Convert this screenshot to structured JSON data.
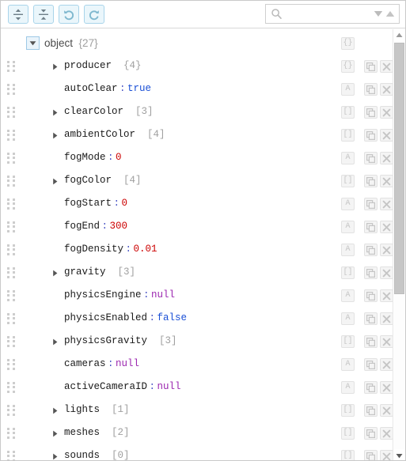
{
  "toolbar": {
    "buttons": [
      {
        "name": "expand-all-button",
        "icon": "expand-vertical-icon",
        "title": "Expand all"
      },
      {
        "name": "collapse-all-button",
        "icon": "collapse-vertical-icon",
        "title": "Collapse all"
      },
      {
        "name": "undo-button",
        "icon": "undo-icon",
        "title": "Undo"
      },
      {
        "name": "redo-button",
        "icon": "redo-icon",
        "title": "Redo"
      }
    ],
    "search": {
      "value": "",
      "placeholder": "",
      "icon": "search-icon",
      "next_icon": "triangle-down-icon",
      "prev_icon": "triangle-up-icon"
    }
  },
  "colors": {
    "number": "#cc0000",
    "boolean": "#1a4fd6",
    "null": "#9c27b0",
    "key": "#1a1a1a",
    "colon": "#4652c4",
    "count": "#a0a0a0",
    "accent": "#a8d4ea"
  },
  "tree": {
    "root": {
      "label": "object",
      "count": "{27}",
      "expanded": true,
      "type_icon": "{}"
    },
    "rows": [
      {
        "key": "producer",
        "count": "{4}",
        "has_twisty": true,
        "value": null,
        "value_type": "none",
        "type_icon": "{}"
      },
      {
        "key": "autoClear",
        "count": "",
        "has_twisty": false,
        "value": "true",
        "value_type": "boolean",
        "type_icon": "A"
      },
      {
        "key": "clearColor",
        "count": "[3]",
        "has_twisty": true,
        "value": null,
        "value_type": "none",
        "type_icon": "[]"
      },
      {
        "key": "ambientColor",
        "count": "[4]",
        "has_twisty": true,
        "value": null,
        "value_type": "none",
        "type_icon": "[]"
      },
      {
        "key": "fogMode",
        "count": "",
        "has_twisty": false,
        "value": "0",
        "value_type": "number",
        "type_icon": "A"
      },
      {
        "key": "fogColor",
        "count": "[4]",
        "has_twisty": true,
        "value": null,
        "value_type": "none",
        "type_icon": "[]"
      },
      {
        "key": "fogStart",
        "count": "",
        "has_twisty": false,
        "value": "0",
        "value_type": "number",
        "type_icon": "A"
      },
      {
        "key": "fogEnd",
        "count": "",
        "has_twisty": false,
        "value": "300",
        "value_type": "number",
        "type_icon": "A"
      },
      {
        "key": "fogDensity",
        "count": "",
        "has_twisty": false,
        "value": "0.01",
        "value_type": "number",
        "type_icon": "A"
      },
      {
        "key": "gravity",
        "count": "[3]",
        "has_twisty": true,
        "value": null,
        "value_type": "none",
        "type_icon": "[]"
      },
      {
        "key": "physicsEngine",
        "count": "",
        "has_twisty": false,
        "value": "null",
        "value_type": "null",
        "type_icon": "A"
      },
      {
        "key": "physicsEnabled",
        "count": "",
        "has_twisty": false,
        "value": "false",
        "value_type": "boolean",
        "type_icon": "A"
      },
      {
        "key": "physicsGravity",
        "count": "[3]",
        "has_twisty": true,
        "value": null,
        "value_type": "none",
        "type_icon": "[]"
      },
      {
        "key": "cameras",
        "count": "",
        "has_twisty": false,
        "value": "null",
        "value_type": "null",
        "type_icon": "A"
      },
      {
        "key": "activeCameraID",
        "count": "",
        "has_twisty": false,
        "value": "null",
        "value_type": "null",
        "type_icon": "A"
      },
      {
        "key": "lights",
        "count": "[1]",
        "has_twisty": true,
        "value": null,
        "value_type": "none",
        "type_icon": "[]"
      },
      {
        "key": "meshes",
        "count": "[2]",
        "has_twisty": true,
        "value": null,
        "value_type": "none",
        "type_icon": "[]"
      },
      {
        "key": "sounds",
        "count": "[0]",
        "has_twisty": true,
        "value": null,
        "value_type": "none",
        "type_icon": "[]"
      }
    ],
    "row_actions": {
      "copy_icon": "duplicate-icon",
      "delete_icon": "close-x-icon"
    }
  },
  "scrollbar": {
    "up_icon": "triangle-up-icon",
    "down_icon": "triangle-down-icon",
    "thumb_position": "top",
    "thumb_fraction": 0.6
  }
}
